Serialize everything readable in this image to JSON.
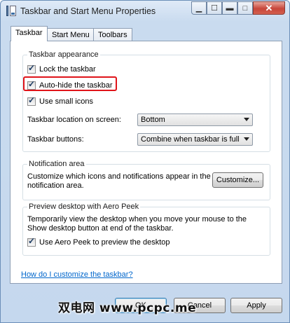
{
  "window": {
    "title": "Taskbar and Start Menu Properties",
    "close_glyph": "✕",
    "help_glyph": "?"
  },
  "tabs": [
    {
      "label": "Taskbar"
    },
    {
      "label": "Start Menu"
    },
    {
      "label": "Toolbars"
    }
  ],
  "taskbar_appearance": {
    "heading": "Taskbar appearance",
    "lock": {
      "label": "Lock the taskbar",
      "checked": true
    },
    "autohide": {
      "label": "Auto-hide the taskbar",
      "checked": true
    },
    "small_icons": {
      "label": "Use small icons",
      "checked": true
    },
    "location_label": "Taskbar location on screen:",
    "location_value": "Bottom",
    "buttons_label": "Taskbar buttons:",
    "buttons_value": "Combine when taskbar is full"
  },
  "notification_area": {
    "heading": "Notification area",
    "description": "Customize which icons and notifications appear in the notification area.",
    "customize_button": "Customize..."
  },
  "aero_peek": {
    "heading": "Preview desktop with Aero Peek",
    "description": "Temporarily view the desktop when you move your mouse to the Show desktop button at end of the taskbar.",
    "checkbox": {
      "label": "Use Aero Peek to preview the desktop",
      "checked": true
    }
  },
  "help_link": "How do I customize the taskbar?",
  "footer": {
    "ok": "OK",
    "cancel": "Cancel",
    "apply": "Apply"
  },
  "watermark": "双电网 www.pcpc.me",
  "colors": {
    "highlight_border": "#e0141a",
    "link": "#0066cc",
    "close_button": "#c7463a"
  },
  "icons": {
    "check": "✓"
  }
}
